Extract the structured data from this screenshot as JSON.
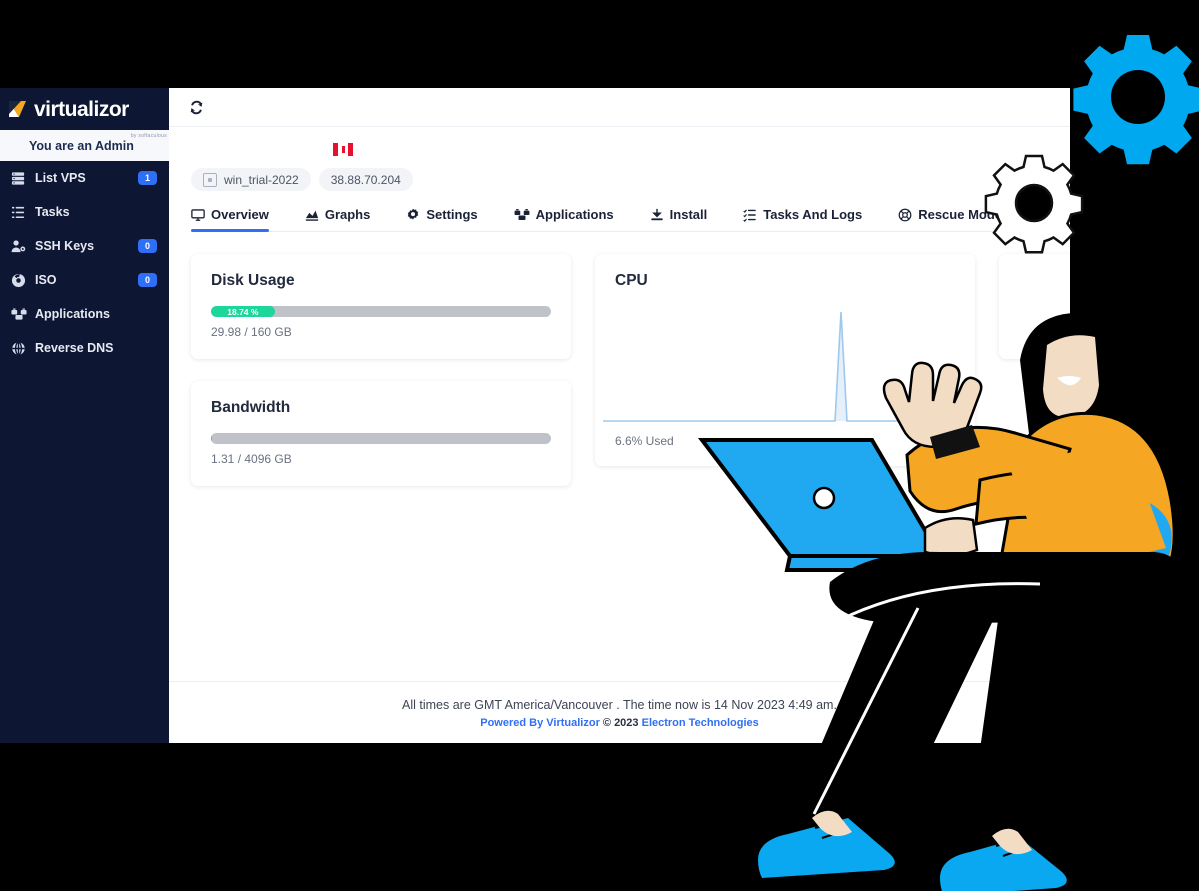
{
  "brand": {
    "name": "virtualizor",
    "tagline": "by softaculous",
    "logo_color": "#f5a623"
  },
  "sidebar": {
    "admin_notice": "You are an Admin",
    "background": "#0d1633",
    "badge_color": "#2f6ff5",
    "items": [
      {
        "label": "List VPS",
        "icon": "server-icon",
        "badge": "1"
      },
      {
        "label": "Tasks",
        "icon": "list-icon",
        "badge": ""
      },
      {
        "label": "SSH Keys",
        "icon": "user-key-icon",
        "badge": "0"
      },
      {
        "label": "ISO",
        "icon": "disc-icon",
        "badge": "0"
      },
      {
        "label": "Applications",
        "icon": "apps-icon",
        "badge": ""
      },
      {
        "label": "Reverse DNS",
        "icon": "globe-icon",
        "badge": ""
      }
    ]
  },
  "topbar": {
    "refresh_icon": "refresh-icon"
  },
  "vps": {
    "flag": "canada-flag",
    "hostname_chip": "win_trial-2022",
    "ip_chip": "38.88.70.204"
  },
  "tabs": [
    {
      "label": "Overview",
      "icon": "monitor-icon",
      "active": true
    },
    {
      "label": "Graphs",
      "icon": "chart-icon",
      "active": false
    },
    {
      "label": "Settings",
      "icon": "gear-icon",
      "active": false
    },
    {
      "label": "Applications",
      "icon": "apps-icon",
      "active": false
    },
    {
      "label": "Install",
      "icon": "download-icon",
      "active": false
    },
    {
      "label": "Tasks And Logs",
      "icon": "tasklist-icon",
      "active": false
    },
    {
      "label": "Rescue Mode",
      "icon": "lifebuoy-icon",
      "active": false
    }
  ],
  "cards": {
    "disk": {
      "title": "Disk Usage",
      "percent_label": "18.74 %",
      "percent_value": 18.74,
      "caption": "29.98 / 160 GB",
      "fill_color": "#1ed69a"
    },
    "bandwidth": {
      "title": "Bandwidth",
      "percent_label": "",
      "percent_value": 0.03,
      "caption": "1.31 / 4096 GB",
      "fill_color": "#1ed69a"
    },
    "cpu": {
      "title": "CPU",
      "caption": "6.6% Used"
    }
  },
  "chart_data": {
    "type": "area",
    "title": "CPU",
    "series": [
      {
        "name": "CPU Used %",
        "values": [
          0,
          0,
          0,
          0,
          0,
          0,
          0,
          0,
          0,
          0,
          0,
          6.6,
          0,
          0
        ]
      }
    ],
    "x": [
      1,
      2,
      3,
      4,
      5,
      6,
      7,
      8,
      9,
      10,
      11,
      12,
      13,
      14
    ],
    "xlabel": "",
    "ylabel": "",
    "ylim": [
      0,
      8
    ],
    "grid": false,
    "legend": "none",
    "annotation": "6.6% Used",
    "line_color": "#9ec9ee",
    "fill_color": "#cfe4f7"
  },
  "footer": {
    "timezone_line": "All times are GMT America/Vancouver . The time now is 14 Nov 2023 4:49 am.",
    "powered_prefix": "Powered By Virtualizor",
    "copyright": "© 2023",
    "company": "Electron Technologies"
  },
  "decor": {
    "gear_filled_color": "#00a8f0",
    "gear_outline_color": "#ffffff",
    "laptop_color": "#20a9f0",
    "shirt_color": "#f5a623",
    "skin_color": "#f2dcc4",
    "shoe_color": "#0aa8f0"
  }
}
